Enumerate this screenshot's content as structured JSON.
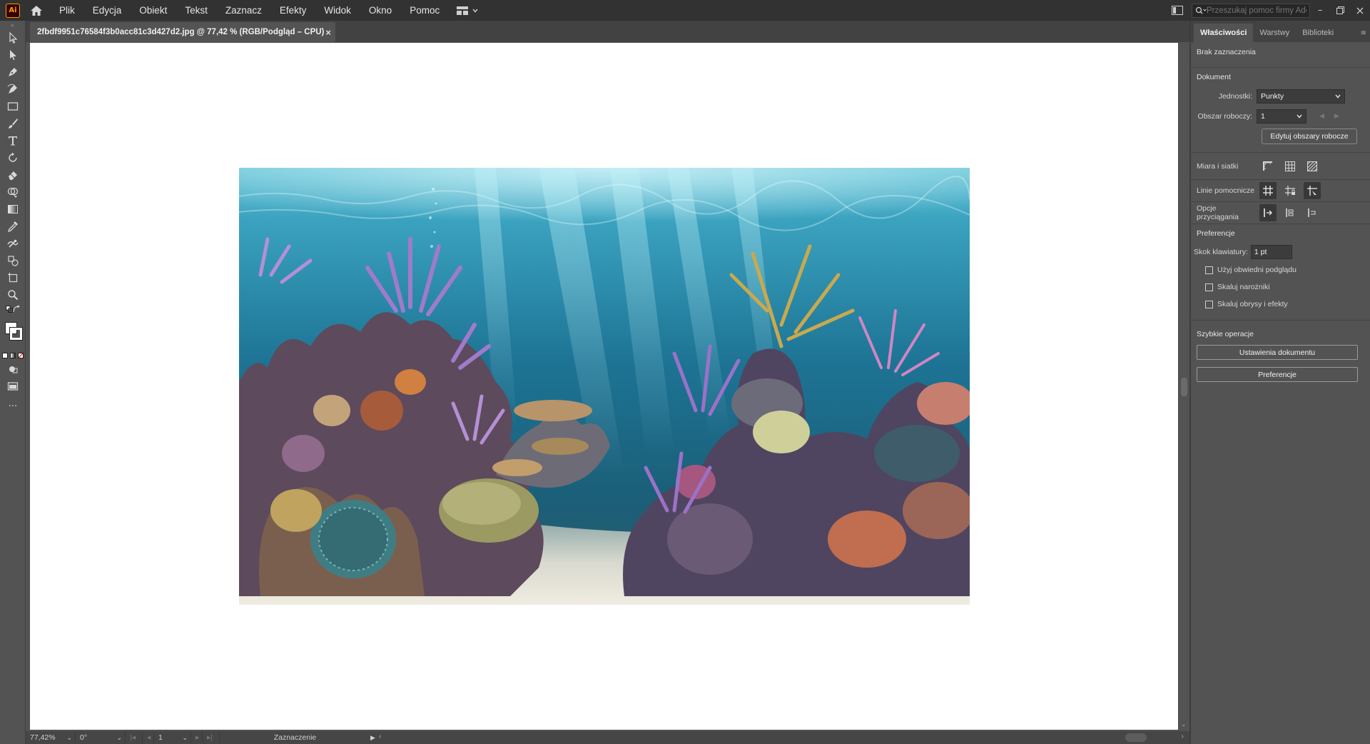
{
  "app": {
    "logo_text": "Ai"
  },
  "menu": {
    "items": [
      "Plik",
      "Edycja",
      "Obiekt",
      "Tekst",
      "Zaznacz",
      "Efekty",
      "Widok",
      "Okno",
      "Pomoc"
    ],
    "help_search_placeholder": "Przeszukaj pomoc firmy Adobe"
  },
  "document": {
    "tab_title": "2fbdf9951c76584f3b0acc81c3d427d2.jpg @ 77,42 % (RGB/Podgląd – CPU)",
    "tab_close": "×"
  },
  "toolbar": {
    "tools": [
      "selection-tool",
      "direct-selection-tool",
      "pen-tool",
      "curvature-tool",
      "rectangle-tool",
      "paintbrush-tool",
      "type-tool",
      "rotate-tool",
      "eraser-tool",
      "shape-builder-tool",
      "gradient-tool",
      "eyedropper-tool",
      "blend-tool",
      "symbol-sprayer-tool",
      "artboard-tool",
      "zoom-tool"
    ],
    "fill_color": "#ffffff",
    "more": "···"
  },
  "statusbar": {
    "zoom": "77,42%",
    "rotation": "0°",
    "artboard_number": "1",
    "tool_name": "Zaznaczenie"
  },
  "panel": {
    "tabs": [
      "Właściwości",
      "Warstwy",
      "Biblioteki"
    ],
    "active_tab": "Właściwości",
    "no_selection": "Brak zaznaczenia",
    "document_section": {
      "title": "Dokument",
      "units_label": "Jednostki:",
      "units_value": "Punkty",
      "artboard_label": "Obszar roboczy:",
      "artboard_value": "1",
      "edit_artboards_button": "Edytuj obszary robocze"
    },
    "rulers_label": "Miara i siatki",
    "guides_label": "Linie pomocnicze",
    "snap_label": "Opcje przyciągania",
    "preferences_section": {
      "title": "Preferencje",
      "keyboard_increment_label": "Skok klawiatury:",
      "keyboard_increment_value": "1 pt",
      "checkboxes": [
        "Użyj obwiedni podglądu",
        "Skaluj narożniki",
        "Skaluj obrysy i efekty"
      ]
    },
    "quick_actions": {
      "title": "Szybkie operacje",
      "document_setup_button": "Ustawienia dokumentu",
      "preferences_button": "Preferencje"
    }
  },
  "canvas": {
    "image_description_hidden": "",
    "accent": "#ff9a00"
  }
}
